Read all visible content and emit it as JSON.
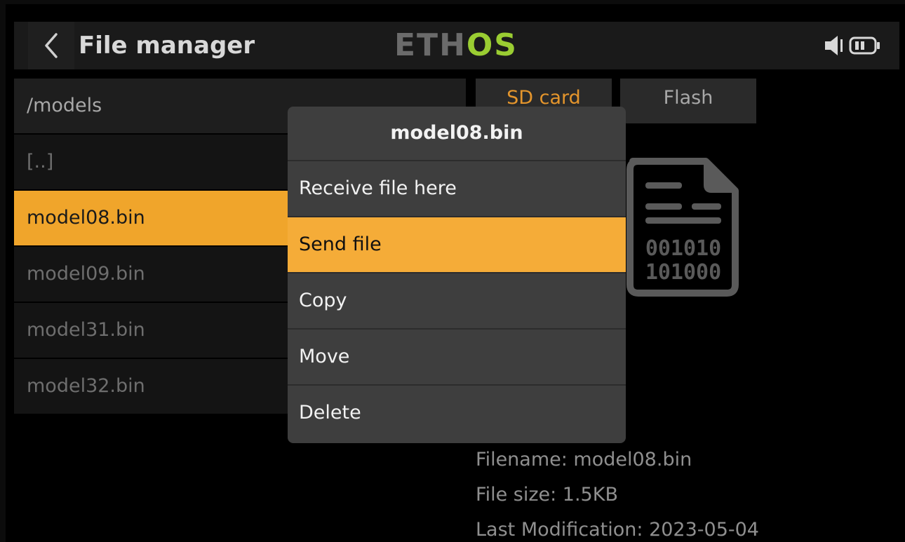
{
  "header": {
    "title": "File manager",
    "logo_part1": "ETH",
    "logo_part2": "OS"
  },
  "file_list": {
    "path": "/models",
    "items": [
      "[..]",
      "model08.bin",
      "model09.bin",
      "model31.bin",
      "model32.bin"
    ],
    "selected_index": 1
  },
  "storage_tabs": [
    "SD card",
    "Flash"
  ],
  "file_icon": {
    "line1": "001010",
    "line2": "101000"
  },
  "file_info": {
    "filename": "Filename: model08.bin",
    "size": "File size: 1.5KB",
    "modified": "Last Modification: 2023-05-04"
  },
  "modal": {
    "title": "model08.bin",
    "items": [
      "Receive file here",
      "Send file",
      "Copy",
      "Move",
      "Delete"
    ],
    "highlighted_index": 1
  },
  "colors": {
    "accent": "#f5ac38",
    "logo_green": "#9acd32"
  }
}
